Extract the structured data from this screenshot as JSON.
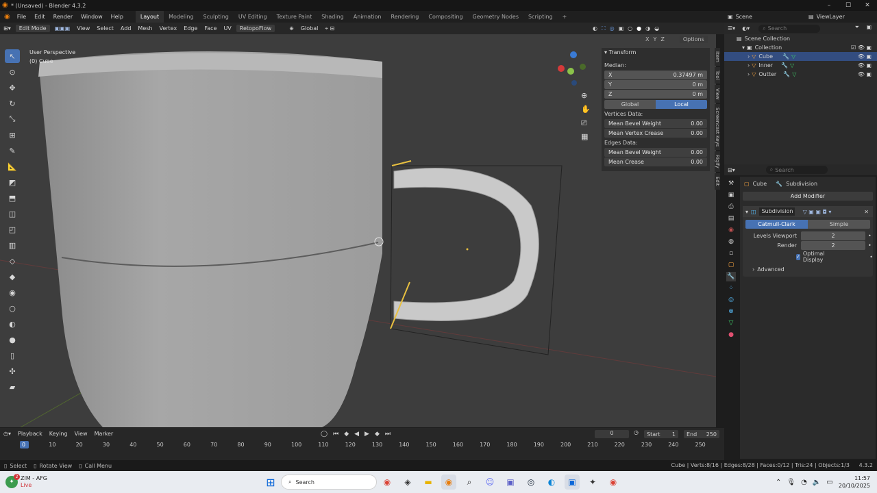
{
  "title_bar": {
    "title": "* (Unsaved) - Blender 4.3.2",
    "minimize": "–",
    "maximize": "☐",
    "close": "✕"
  },
  "menu": {
    "items": [
      "File",
      "Edit",
      "Render",
      "Window",
      "Help"
    ],
    "workspaces": [
      "Layout",
      "Modeling",
      "Sculpting",
      "UV Editing",
      "Texture Paint",
      "Shading",
      "Animation",
      "Rendering",
      "Compositing",
      "Geometry Nodes",
      "Scripting",
      "+"
    ],
    "scene": "Scene",
    "view_layer": "ViewLayer"
  },
  "viewport_header": {
    "mode": "Edit Mode",
    "menus": [
      "View",
      "Select",
      "Add",
      "Mesh",
      "Vertex",
      "Edge",
      "Face",
      "UV",
      "RetopoFlow"
    ],
    "orientation": "Global",
    "options": "Options",
    "axes": [
      "X",
      "Y",
      "Z"
    ]
  },
  "viewport": {
    "perspective": "User Perspective",
    "object": "(0) Cube"
  },
  "n_panel": {
    "title": "Transform",
    "median_label": "Median:",
    "fields": [
      {
        "label": "X",
        "value": "0.37497 m"
      },
      {
        "label": "Y",
        "value": "0 m"
      },
      {
        "label": "Z",
        "value": "0 m"
      }
    ],
    "space_global": "Global",
    "space_local": "Local",
    "vertices_label": "Vertices Data:",
    "vertices": [
      {
        "label": "Mean Bevel Weight",
        "value": "0.00"
      },
      {
        "label": "Mean Vertex Crease",
        "value": "0.00"
      }
    ],
    "edges_label": "Edges Data:",
    "edges": [
      {
        "label": "Mean Bevel Weight",
        "value": "0.00"
      },
      {
        "label": "Mean Crease",
        "value": "0.00"
      }
    ],
    "tabs": [
      "Item",
      "Tool",
      "View",
      "Screencast Keys",
      "Rigify",
      "Edit"
    ]
  },
  "timeline": {
    "menus": [
      "Playback",
      "Keying",
      "View",
      "Marker"
    ],
    "current_frame": "0",
    "start_label": "Start",
    "start": "1",
    "end_label": "End",
    "end": "250",
    "ticks": [
      "0",
      "10",
      "20",
      "30",
      "40",
      "50",
      "60",
      "70",
      "80",
      "90",
      "100",
      "110",
      "120",
      "130",
      "140",
      "150",
      "160",
      "170",
      "180",
      "190",
      "200",
      "210",
      "220",
      "230",
      "240",
      "250"
    ]
  },
  "status_bar": {
    "left": [
      "Select",
      "Rotate View",
      "Call Menu"
    ],
    "stats": "Cube | Verts:8/16 | Edges:8/28 | Faces:0/12 | Tris:24 | Objects:1/3",
    "version": "4.3.2"
  },
  "outliner": {
    "search_placeholder": "Search",
    "root": "Scene Collection",
    "collection": "Collection",
    "objects": [
      "Cube",
      "Inner",
      "Outter"
    ]
  },
  "properties": {
    "search_placeholder": "Search",
    "breadcrumb_object": "Cube",
    "breadcrumb_modifier": "Subdivision",
    "add_modifier": "Add Modifier",
    "modifier_name": "Subdivision",
    "catmull_clark": "Catmull-Clark",
    "simple": "Simple",
    "levels_viewport_label": "Levels Viewport",
    "levels_viewport": "2",
    "render_label": "Render",
    "render": "2",
    "optimal_display": "Optimal Display",
    "advanced": "Advanced"
  },
  "taskbar": {
    "weather_title": "ZIM - AFG",
    "weather_sub": "Live",
    "weather_badge": "2",
    "search": "Search",
    "time": "11:57",
    "date": "20/10/2025"
  },
  "colors": {
    "accent": "#4772b3",
    "selected_row": "#334d80",
    "viewport_bg": "#3d3d3d",
    "panel_bg": "#2b2b2b"
  }
}
